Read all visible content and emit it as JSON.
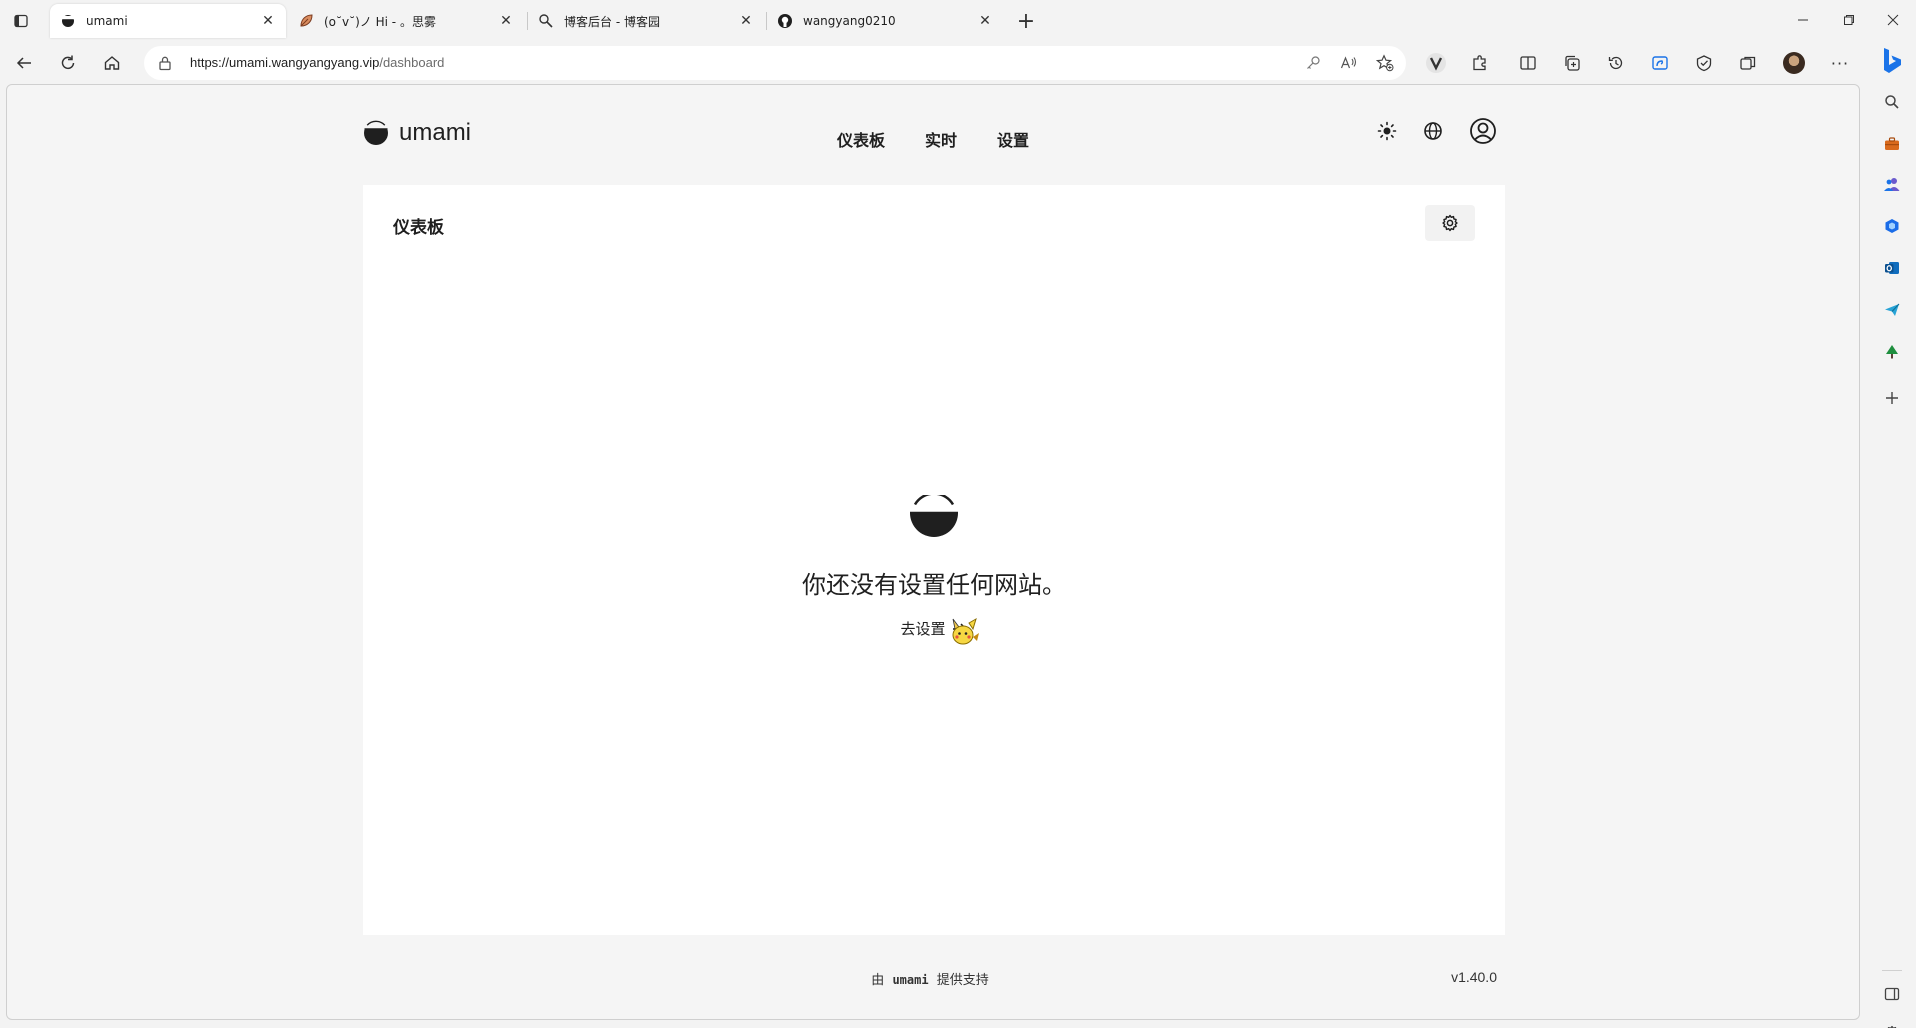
{
  "browser": {
    "tabs": [
      {
        "title": "umami",
        "icon": "umami-logo-icon",
        "active": true
      },
      {
        "title": "(o˘v˘)ノ Hi - 。思雾",
        "icon": "leaf-icon",
        "active": false
      },
      {
        "title": "博客后台 - 博客园",
        "icon": "cnblogs-icon",
        "active": false
      },
      {
        "title": "wangyang0210",
        "icon": "github-icon",
        "active": false
      }
    ],
    "url_host": "https://umami.wangyangyang.vip",
    "url_path": "/dashboard"
  },
  "site": {
    "logo_text": "umami",
    "nav": [
      "仪表板",
      "实时",
      "设置"
    ]
  },
  "dashboard": {
    "title": "仪表板",
    "empty_message": "你还没有设置任何网站。",
    "empty_action": "去设置"
  },
  "footer": {
    "powered_prefix": "由",
    "powered_brand": "umami",
    "powered_suffix": "提供支持",
    "version": "v1.40.0"
  },
  "colors": {
    "text": "#1f1f1f",
    "card_bg": "#ffffff",
    "page_bg": "#f5f5f5",
    "edge_accent": "#1a73e8"
  }
}
